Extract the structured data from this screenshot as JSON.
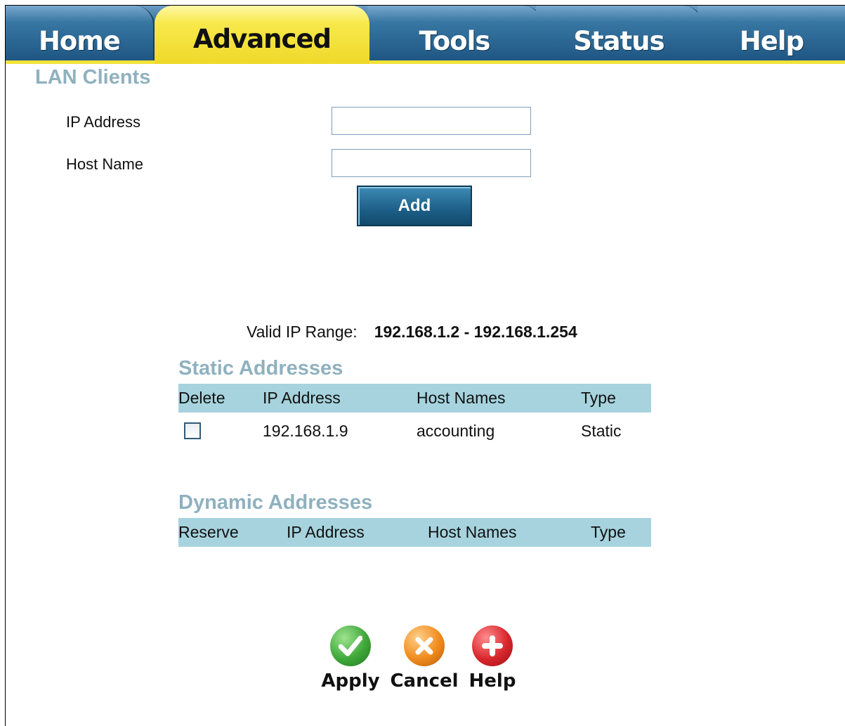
{
  "tabs": [
    {
      "label": "Home"
    },
    {
      "label": "Advanced"
    },
    {
      "label": "Tools"
    },
    {
      "label": "Status"
    },
    {
      "label": "Help"
    }
  ],
  "lan_clients": {
    "title": "LAN Clients",
    "ip_label": "IP Address",
    "ip_value": "",
    "host_label": "Host Name",
    "host_value": "",
    "add_label": "Add"
  },
  "range": {
    "label": "Valid IP Range:",
    "value": "192.168.1.2 -  192.168.1.254"
  },
  "static": {
    "title": "Static Addresses",
    "headers": [
      "Delete",
      "IP Address",
      "Host Names",
      "Type"
    ],
    "rows": [
      {
        "ip": "192.168.1.9",
        "host": "accounting",
        "type": "Static",
        "checked": false
      }
    ]
  },
  "dynamic": {
    "title": "Dynamic Addresses",
    "headers": [
      "Reserve",
      "IP Address",
      "Host Names",
      "Type"
    ],
    "rows": []
  },
  "actions": {
    "apply": "Apply",
    "cancel": "Cancel",
    "help": "Help"
  },
  "colors": {
    "header_bg": "#a6d3de",
    "section_title": "#8fb1bf",
    "active_tab": "#f2e23a",
    "apply": "#3fa83a",
    "cancel": "#f08b1e",
    "help": "#d8262c"
  },
  "icons": {
    "apply": "check-icon",
    "cancel": "x-icon",
    "help": "plus-icon"
  }
}
